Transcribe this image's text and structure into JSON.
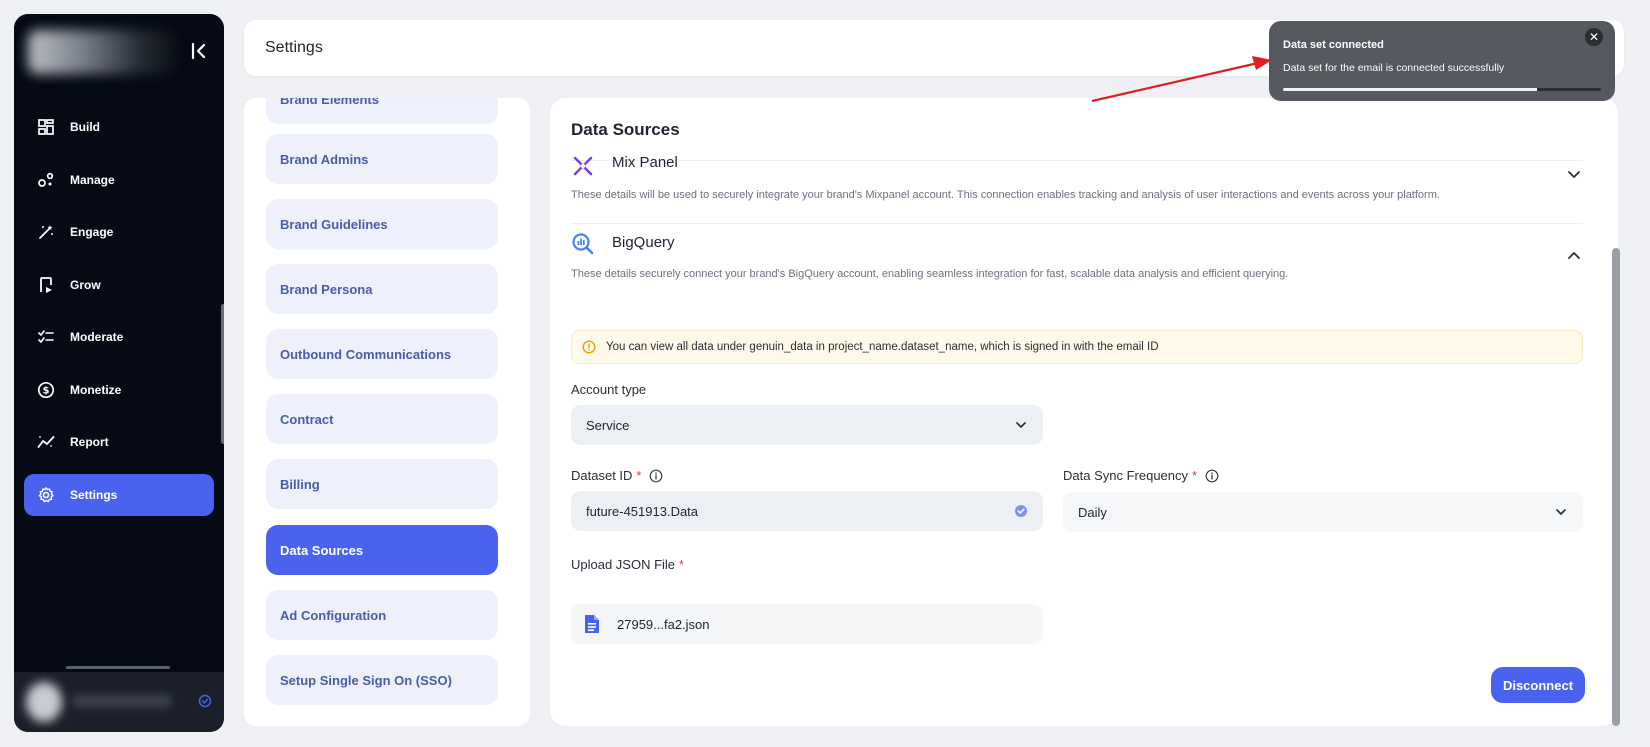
{
  "sidebar": {
    "items": [
      {
        "label": "Build",
        "icon": "build-icon"
      },
      {
        "label": "Manage",
        "icon": "manage-icon"
      },
      {
        "label": "Engage",
        "icon": "engage-icon"
      },
      {
        "label": "Grow",
        "icon": "grow-icon"
      },
      {
        "label": "Moderate",
        "icon": "moderate-icon"
      },
      {
        "label": "Monetize",
        "icon": "monetize-icon"
      },
      {
        "label": "Report",
        "icon": "report-icon"
      },
      {
        "label": "Settings",
        "icon": "settings-icon",
        "active": true
      }
    ]
  },
  "header": {
    "title": "Settings"
  },
  "settings_menu": {
    "items": [
      {
        "label": "Brand Elements"
      },
      {
        "label": "Brand Admins"
      },
      {
        "label": "Brand Guidelines"
      },
      {
        "label": "Brand Persona"
      },
      {
        "label": "Outbound Communications"
      },
      {
        "label": "Contract"
      },
      {
        "label": "Billing"
      },
      {
        "label": "Data Sources",
        "active": true
      },
      {
        "label": "Ad Configuration"
      },
      {
        "label": "Setup Single Sign On (SSO)"
      }
    ]
  },
  "data_sources": {
    "title": "Data Sources",
    "mixpanel": {
      "name": "Mix Panel",
      "description": "These details will be used to securely integrate your brand's Mixpanel account. This connection enables tracking and analysis of user interactions and events across your platform."
    },
    "bigquery": {
      "name": "BigQuery",
      "description": "These details securely connect your brand's BigQuery account, enabling seamless integration for fast, scalable data analysis and efficient querying.",
      "notice": "You can view all data under genuin_data in project_name.dataset_name, which is signed in with the email ID",
      "account_type_label": "Account type",
      "account_type_value": "Service",
      "dataset_id_label": "Dataset ID",
      "dataset_id_value": "future-451913.Data",
      "sync_label": "Data Sync Frequency",
      "sync_value": "Daily",
      "upload_label": "Upload JSON File",
      "file_name": "27959...fa2.json",
      "disconnect_label": "Disconnect"
    }
  },
  "toast": {
    "title": "Data set connected",
    "message": "Data set for the email is connected successfully",
    "progress": 0.8
  },
  "colors": {
    "accent": "#4a63ee",
    "sidebar_bg": "#050a14",
    "toast_bg": "#55585e",
    "arrow": "#e02020"
  }
}
